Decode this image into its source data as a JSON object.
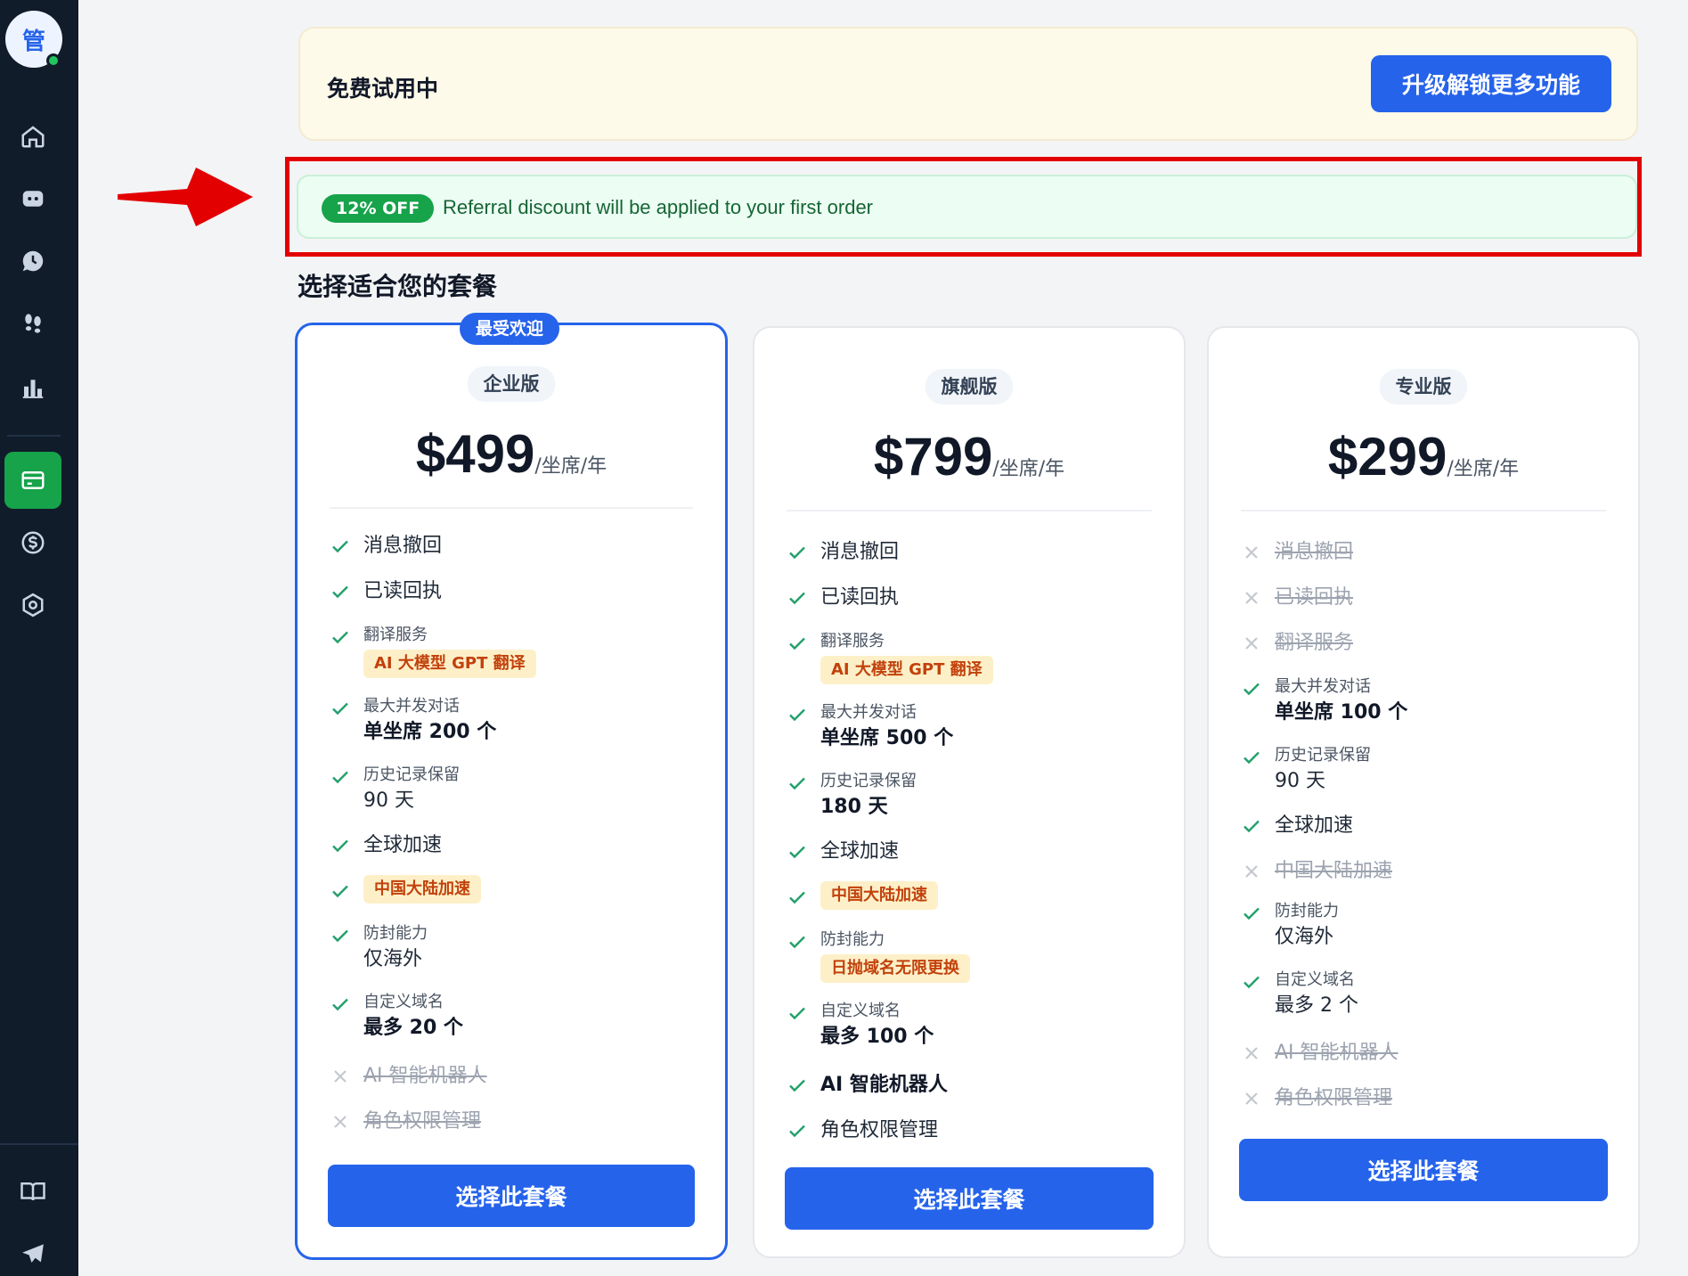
{
  "sidebar": {
    "avatar_text": "管",
    "items": [
      {
        "icon": "home-icon"
      },
      {
        "icon": "chat-bot-icon"
      },
      {
        "icon": "history-chat-icon"
      },
      {
        "icon": "footprints-icon"
      },
      {
        "icon": "bar-chart-icon"
      },
      {
        "icon": "credit-card-icon",
        "active": true
      },
      {
        "icon": "dollar-icon"
      },
      {
        "icon": "settings-icon"
      },
      {
        "icon": "book-icon"
      },
      {
        "icon": "telegram-icon"
      }
    ],
    "active_color": "#16a34a"
  },
  "trial": {
    "text": "免费试用中",
    "upgrade_label": "升级解锁更多功能"
  },
  "referral": {
    "badge": "12% OFF",
    "text": "Referral discount will be applied to your first order"
  },
  "section_title": "选择适合您的套餐",
  "plans": [
    {
      "name": "企业版",
      "badge": "最受欢迎",
      "price": "$499",
      "unit": "/坐席/年",
      "features": {
        "recall": "消息撤回",
        "read_receipt": "已读回执",
        "translate_label": "翻译服务",
        "translate_tag": "AI 大模型 GPT 翻译",
        "concurrent_label": "最大并发对话",
        "concurrent_value": "单坐席 200 个",
        "history_label": "历史记录保留",
        "history_value": "90 天",
        "global": "全球加速",
        "mainland_tag": "中国大陆加速",
        "antiblock_label": "防封能力",
        "antiblock_value": "仅海外",
        "domain_label": "自定义域名",
        "domain_value": "最多 20 个",
        "ai_bot": "AI 智能机器人",
        "roles": "角色权限管理"
      },
      "cta": "选择此套餐"
    },
    {
      "name": "旗舰版",
      "price": "$799",
      "unit": "/坐席/年",
      "features": {
        "recall": "消息撤回",
        "read_receipt": "已读回执",
        "translate_label": "翻译服务",
        "translate_tag": "AI 大模型 GPT 翻译",
        "concurrent_label": "最大并发对话",
        "concurrent_value": "单坐席 500 个",
        "history_label": "历史记录保留",
        "history_value": "180 天",
        "global": "全球加速",
        "mainland_tag": "中国大陆加速",
        "antiblock_label": "防封能力",
        "antiblock_tag": "日抛域名无限更换",
        "domain_label": "自定义域名",
        "domain_value": "最多 100 个",
        "ai_bot": "AI 智能机器人",
        "roles": "角色权限管理"
      },
      "cta": "选择此套餐"
    },
    {
      "name": "专业版",
      "price": "$299",
      "unit": "/坐席/年",
      "features": {
        "recall": "消息撤回",
        "read_receipt": "已读回执",
        "translate_label": "翻译服务",
        "concurrent_label": "最大并发对话",
        "concurrent_value": "单坐席 100 个",
        "history_label": "历史记录保留",
        "history_value": "90 天",
        "global": "全球加速",
        "mainland": "中国大陆加速",
        "antiblock_label": "防封能力",
        "antiblock_value": "仅海外",
        "domain_label": "自定义域名",
        "domain_value": "最多 2 个",
        "ai_bot": "AI 智能机器人",
        "roles": "角色权限管理"
      },
      "cta": "选择此套餐"
    }
  ],
  "colors": {
    "primary": "#2563eb",
    "check": "#22a06b",
    "cross": "#c4c8ce",
    "highlight": "#e30000"
  }
}
